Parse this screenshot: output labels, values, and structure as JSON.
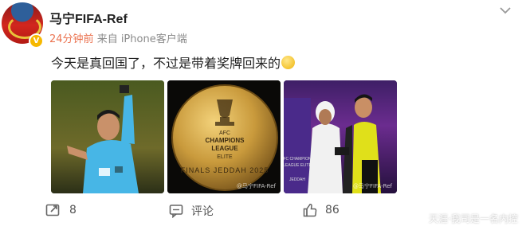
{
  "post": {
    "username": "马宁FIFA-Ref",
    "time": "24分钟前",
    "source": "来自 iPhone客户端",
    "text": "今天是真回国了，不过是带着奖牌回来的",
    "emoji": "smirk-emoji",
    "verified_badge": "V",
    "verified_color": "#f6b800"
  },
  "images": [
    {
      "name": "referee-photo",
      "watermark": ""
    },
    {
      "name": "medal-photo",
      "watermark": "@马宁FIFA-Ref"
    },
    {
      "name": "ceremony-photo",
      "watermark": "@马宁FIFA-Ref"
    }
  ],
  "actions": {
    "repost_count": "8",
    "comment_label": "评论",
    "like_count": "86"
  },
  "overlay": {
    "line1": "下载",
    "line2": "天涯·我司是一名内控"
  },
  "colors": {
    "time_accent": "#eb7350",
    "meta_gray": "#8a8a8a"
  }
}
